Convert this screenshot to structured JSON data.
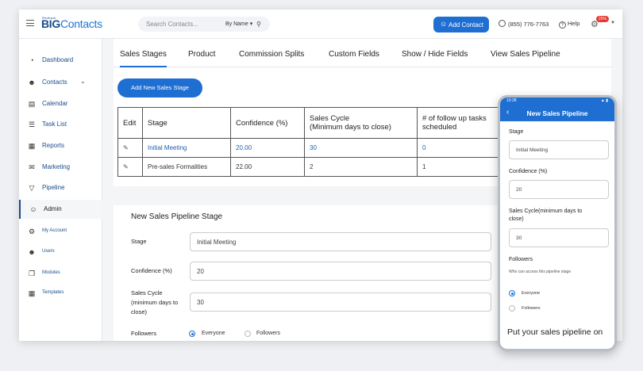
{
  "topbar": {
    "logo_small": "Redtrack",
    "logo_big_a": "BIG",
    "logo_big_b": "Contacts",
    "search_placeholder": "Search Contacts...",
    "search_by": "By Name ▾",
    "add_contact": "Add Contact",
    "phone": "(855) 776-7763",
    "help": "Help",
    "badge": "25%"
  },
  "sidebar": {
    "items": [
      {
        "label": "Dashboard",
        "icon": "dashboard-icon"
      },
      {
        "label": "Contacts",
        "icon": "user-icon"
      },
      {
        "label": "Calendar",
        "icon": "calendar-icon"
      },
      {
        "label": "Task List",
        "icon": "task-list-icon"
      },
      {
        "label": "Reports",
        "icon": "reports-icon"
      },
      {
        "label": "Marketing",
        "icon": "mail-icon"
      },
      {
        "label": "Pipeline",
        "icon": "funnel-icon"
      },
      {
        "label": "Admin",
        "icon": "admin-icon"
      },
      {
        "label": "My Account",
        "icon": "gear-icon"
      },
      {
        "label": "Users",
        "icon": "user-icon"
      },
      {
        "label": "Modules",
        "icon": "modules-icon"
      },
      {
        "label": "Templates",
        "icon": "templates-icon"
      }
    ]
  },
  "tabs": [
    "Sales Stages",
    "Product",
    "Commission Splits",
    "Custom Fields",
    "Show / Hide Fields",
    "View Sales Pipeline"
  ],
  "add_stage_button": "Add New Sales Stage",
  "table": {
    "headers": [
      "Edit",
      "Stage",
      "Confidence (%)",
      "Sales Cycle\n(Minimum days to close)",
      "# of follow up tasks\nscheduled"
    ],
    "rows": [
      {
        "stage": "Initial Meeting",
        "confidence": "20.00",
        "cycle": "30",
        "tasks": "0"
      },
      {
        "stage": "Pre-sales Formalities",
        "confidence": "22.00",
        "cycle": "2",
        "tasks": "1"
      }
    ]
  },
  "form": {
    "title": "New Sales Pipeline Stage",
    "stage_label": "Stage",
    "stage_value": "Initial Meeting",
    "confidence_label": "Confidence (%)",
    "confidence_value": "20",
    "cycle_label": "Sales Cycle (minimum days to close)",
    "cycle_value": "30",
    "followers_label": "Followers",
    "opt_everyone": "Everyone",
    "opt_followers": "Followers"
  },
  "mobile": {
    "time": "10:28",
    "title": "New Sales Pipeline",
    "stage_label": "Stage",
    "stage_value": "Initial Meeting",
    "confidence_label": "Confidence (%)",
    "confidence_value": "20",
    "cycle_label": "Sales Cycle(minimum days to close)",
    "cycle_value": "30",
    "followers_label": "Followers",
    "followers_note": "Who can access this pipeline stage",
    "opt_everyone": "Everyone",
    "opt_followers": "Followers",
    "promo": "Put your sales pipeline on"
  },
  "colors": {
    "accent": "#1f6fd2",
    "brand": "#1a4c8c",
    "badge": "#e53935"
  }
}
